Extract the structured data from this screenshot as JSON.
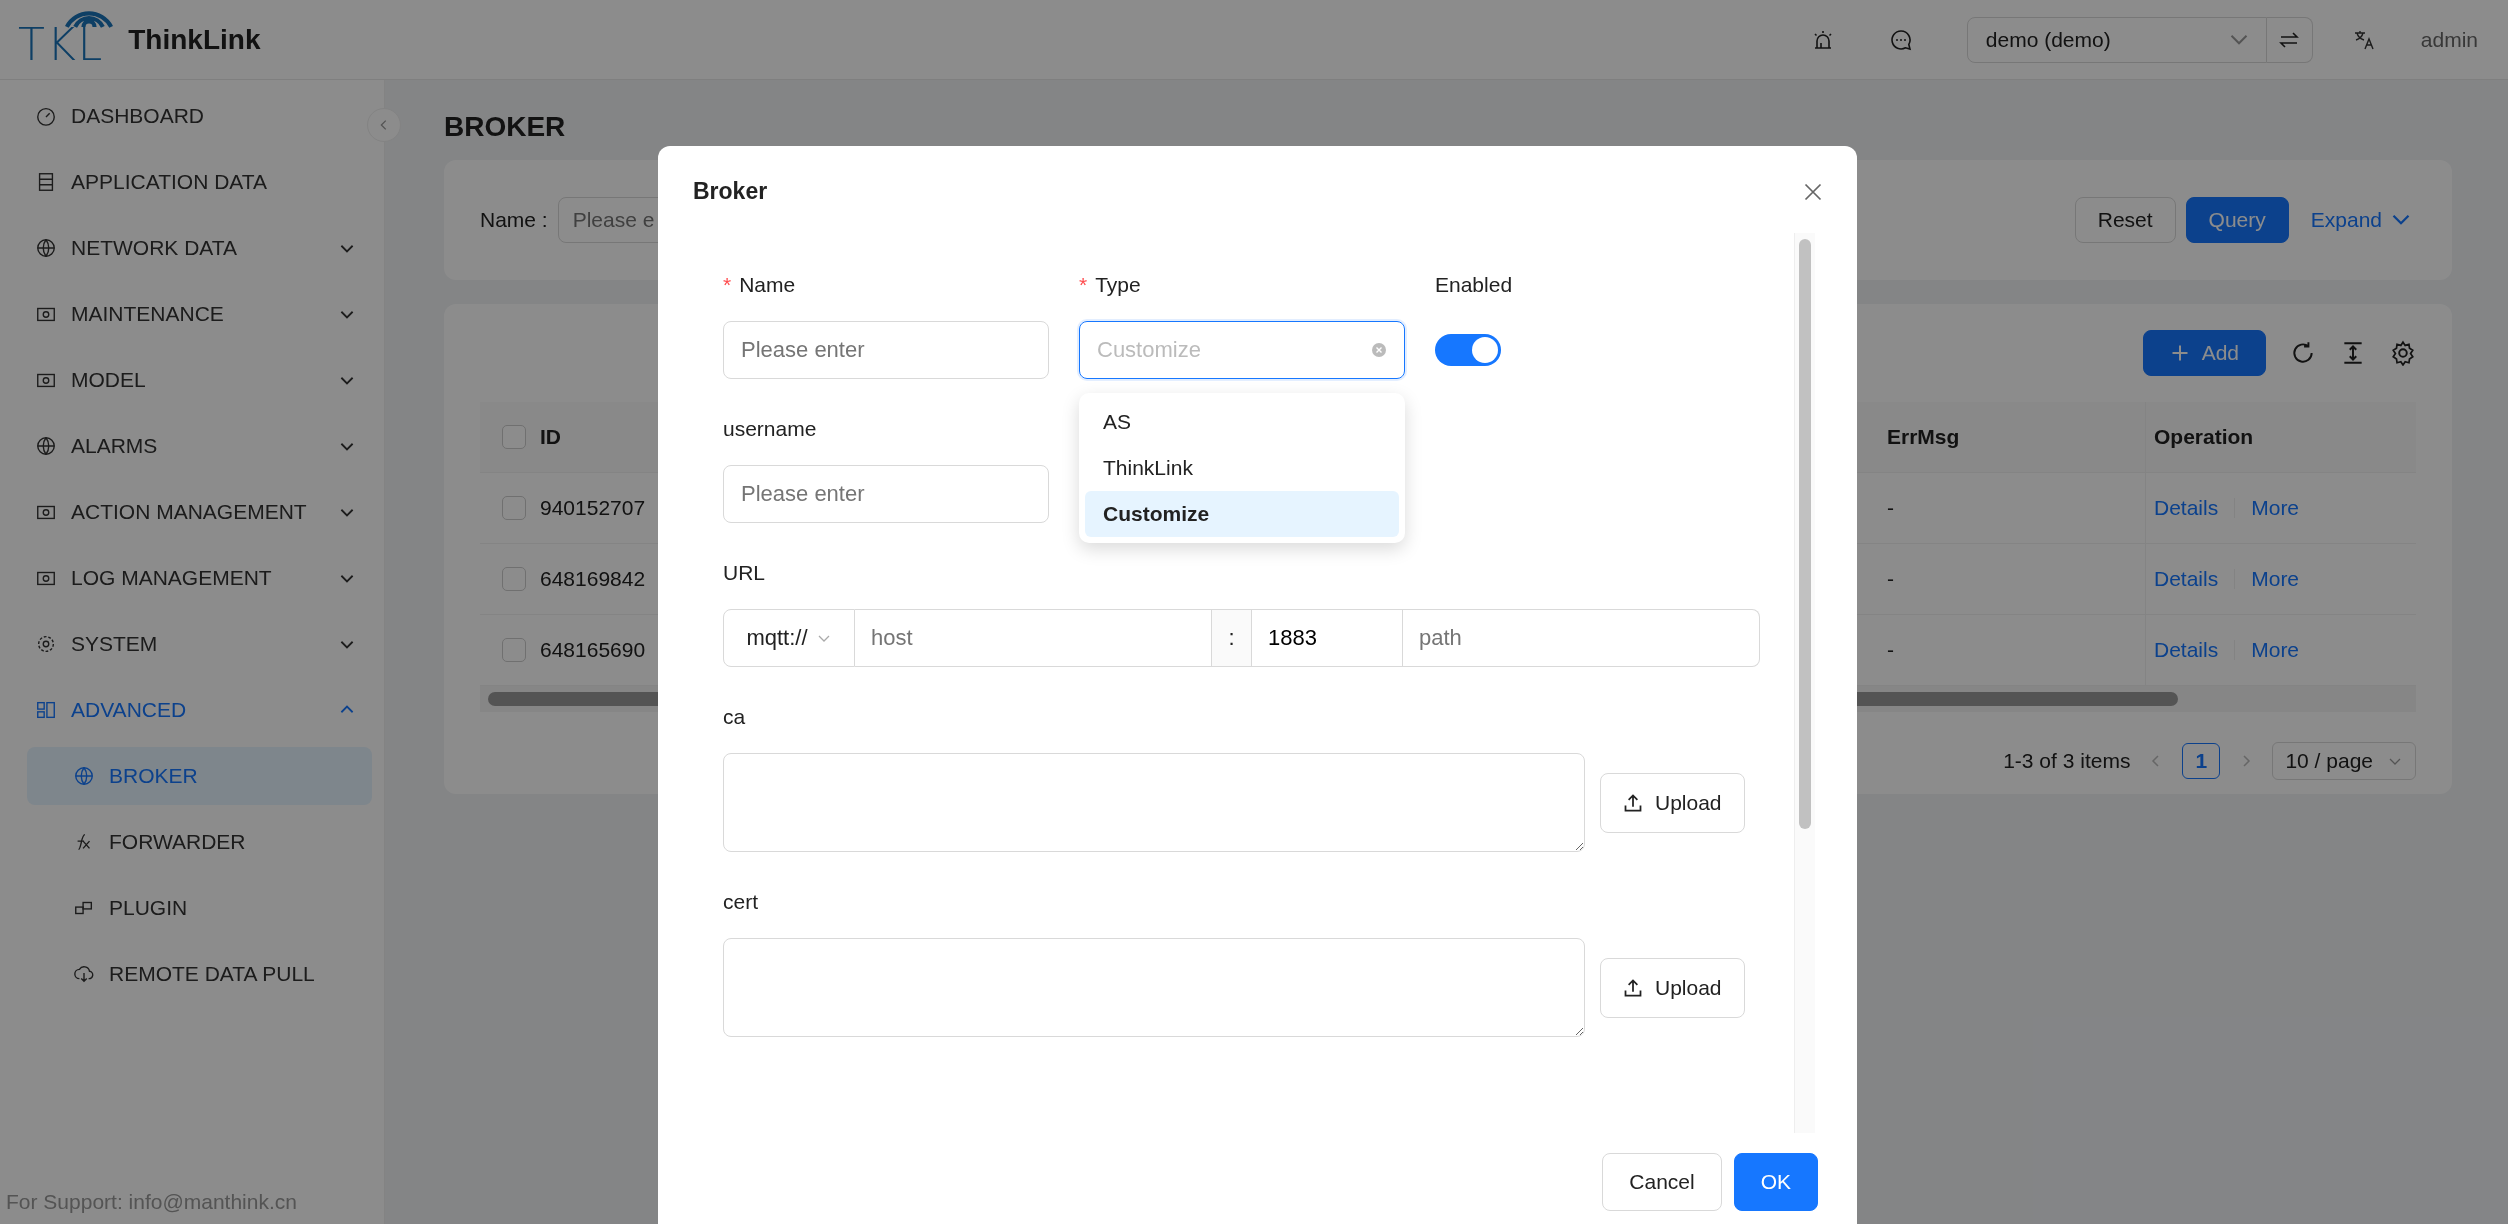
{
  "header": {
    "logo_text": "TKL",
    "app_name": "ThinkLink",
    "org_select": {
      "value": "demo (demo)"
    },
    "user": "admin"
  },
  "sidebar": {
    "items": [
      {
        "label": "DASHBOARD",
        "kind": "link",
        "selected": false
      },
      {
        "label": "APPLICATION DATA",
        "kind": "link",
        "selected": false
      },
      {
        "label": "NETWORK DATA",
        "kind": "submenu",
        "expanded": false,
        "selected": false
      },
      {
        "label": "MAINTENANCE",
        "kind": "submenu",
        "expanded": false,
        "selected": false
      },
      {
        "label": "MODEL",
        "kind": "submenu",
        "expanded": false,
        "selected": false
      },
      {
        "label": "ALARMS",
        "kind": "submenu",
        "expanded": false,
        "selected": false
      },
      {
        "label": "ACTION MANAGEMENT",
        "kind": "submenu",
        "expanded": false,
        "selected": false
      },
      {
        "label": "LOG MANAGEMENT",
        "kind": "submenu",
        "expanded": false,
        "selected": false
      },
      {
        "label": "SYSTEM",
        "kind": "submenu",
        "expanded": false,
        "selected": false
      },
      {
        "label": "ADVANCED",
        "kind": "submenu",
        "expanded": true,
        "selected": true,
        "children": [
          {
            "label": "BROKER",
            "selected": true
          },
          {
            "label": "FORWARDER",
            "selected": false
          },
          {
            "label": "PLUGIN",
            "selected": false
          },
          {
            "label": "REMOTE DATA PULL",
            "selected": false
          }
        ]
      }
    ],
    "support": "For Support: info@manthink.cn"
  },
  "page": {
    "title": "BROKER",
    "filter": {
      "label": "Name :",
      "placeholder": "Please e",
      "buttons": [
        "Reset",
        "Query"
      ],
      "expand": "Expand"
    },
    "table": {
      "add_button": "Add",
      "columns": [
        "ID",
        "ErrMsg",
        "Operation"
      ],
      "all_checked": false,
      "rows": [
        {
          "checked": false,
          "id": "940152707",
          "errmsg": "-",
          "actions": [
            "Details",
            "More"
          ]
        },
        {
          "checked": false,
          "id": "648169842",
          "errmsg": "-",
          "actions": [
            "Details",
            "More"
          ]
        },
        {
          "checked": false,
          "id": "648165690",
          "errmsg": "-",
          "actions": [
            "Details",
            "More"
          ]
        }
      ],
      "pagination": {
        "summary": "1-3 of 3 items",
        "current": "1",
        "page_size": "10 / page"
      }
    }
  },
  "modal": {
    "title": "Broker",
    "name": {
      "label": "Name",
      "required_mark": "*",
      "placeholder": "Please enter"
    },
    "type": {
      "label": "Type",
      "required_mark": "*",
      "value": "Customize",
      "open": true,
      "options": [
        {
          "label": "AS",
          "selected": false
        },
        {
          "label": "ThinkLink",
          "selected": false
        },
        {
          "label": "Customize",
          "selected": true
        }
      ]
    },
    "enabled": {
      "label": "Enabled",
      "on": true
    },
    "username": {
      "label": "username",
      "placeholder": "Please enter"
    },
    "url": {
      "label": "URL",
      "scheme": "mqtt://",
      "host_placeholder": "host",
      "separator": ":",
      "port": "1883",
      "path_placeholder": "path"
    },
    "files": [
      {
        "label": "ca",
        "button": "Upload"
      },
      {
        "label": "cert",
        "button": "Upload"
      }
    ],
    "buttons": [
      "Cancel",
      "OK"
    ]
  }
}
